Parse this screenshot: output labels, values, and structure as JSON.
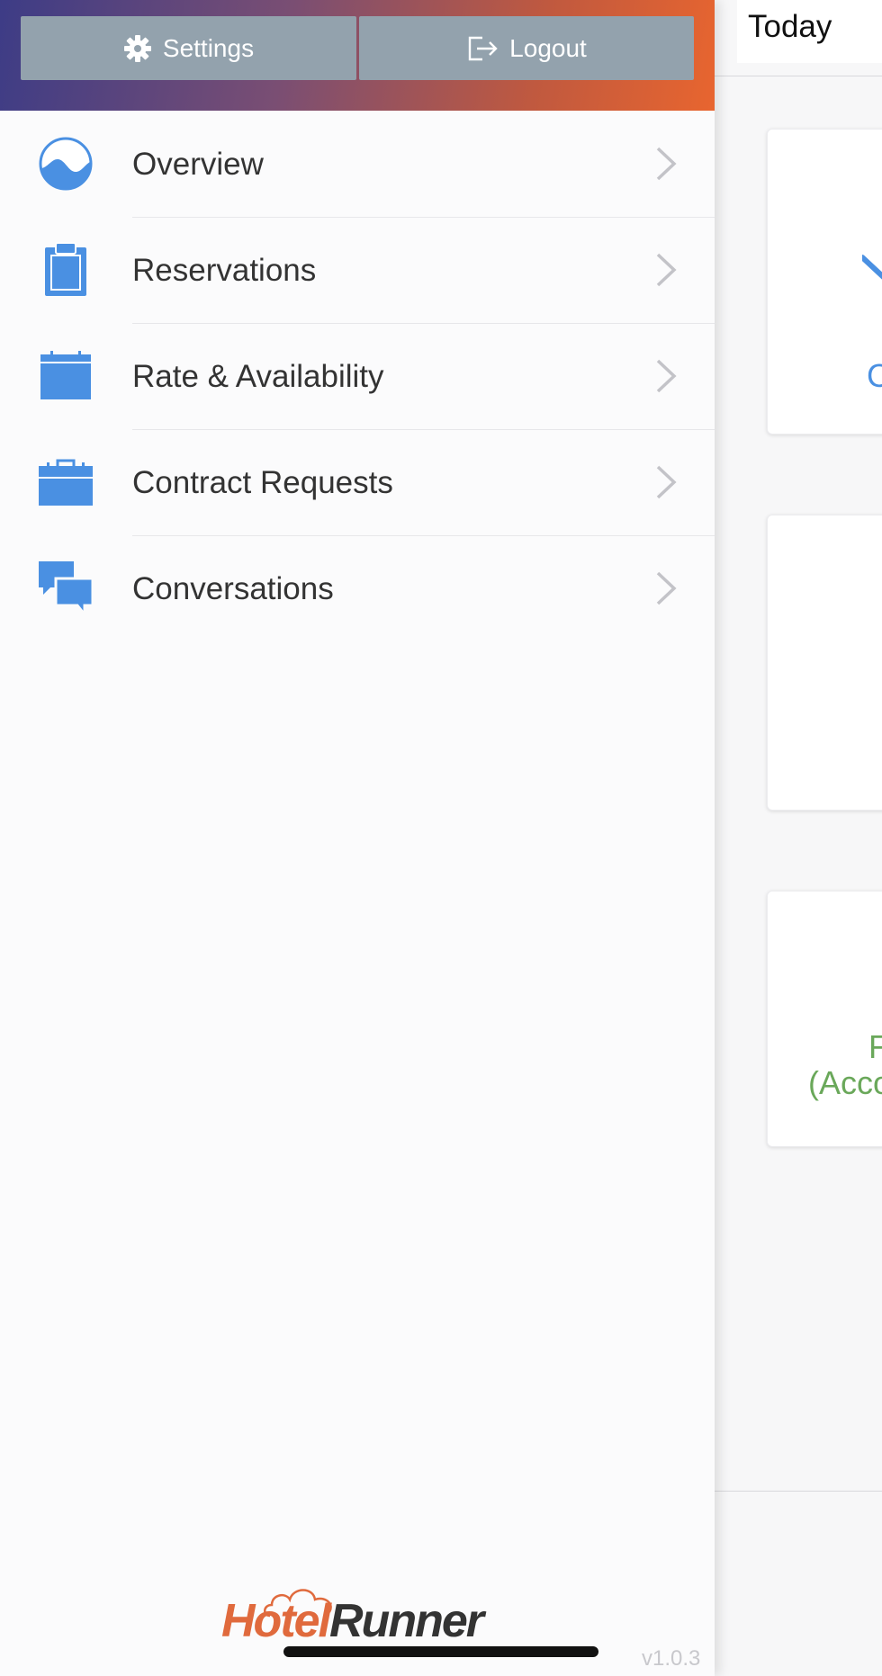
{
  "header": {
    "settings_label": "Settings",
    "logout_label": "Logout"
  },
  "menu": {
    "items": [
      {
        "label": "Overview",
        "icon": "overview-wave-icon"
      },
      {
        "label": "Reservations",
        "icon": "clipboard-icon"
      },
      {
        "label": "Rate & Availability",
        "icon": "calendar-icon"
      },
      {
        "label": "Contract Requests",
        "icon": "briefcase-icon"
      },
      {
        "label": "Conversations",
        "icon": "chat-bubbles-icon"
      }
    ]
  },
  "content": {
    "tab_label": "Today",
    "card1_text_fragment": "C",
    "card3_line1_fragment": "F",
    "card3_line2_fragment": "(Acco"
  },
  "footer": {
    "logo_part1": "Hotel",
    "logo_part2": "Runner",
    "version": "v1.0.3"
  },
  "colors": {
    "accent_blue": "#4a90e2",
    "header_button_bg": "#93a2ad",
    "brand_orange": "#e06a3d",
    "success_green": "#6aa85a"
  }
}
